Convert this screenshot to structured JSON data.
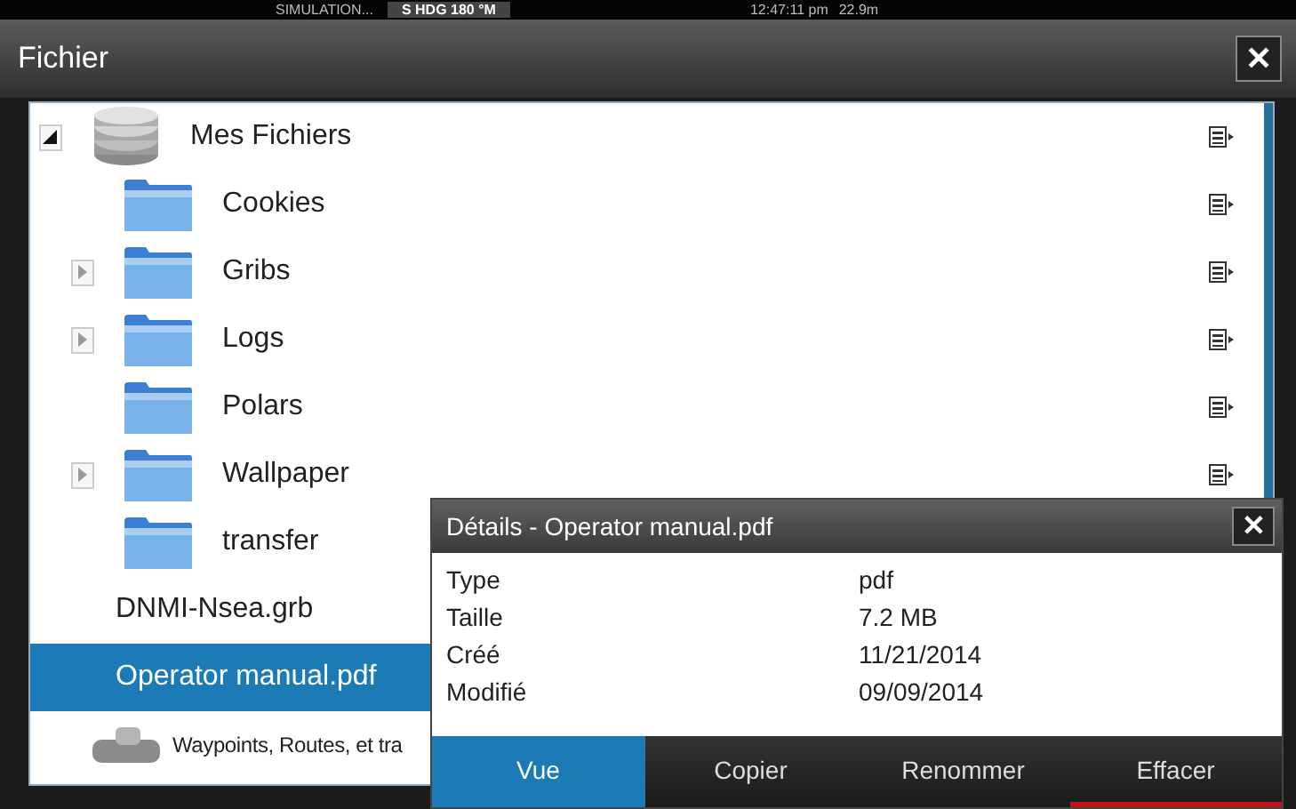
{
  "status_bar": {
    "mode": "SIMULATION...",
    "heading": "S HDG 180 °M",
    "time": "12:47:11 pm",
    "depth": "22.9m"
  },
  "window": {
    "title": "Fichier",
    "close": "✕"
  },
  "files": [
    {
      "name": "Mes Fichiers",
      "kind": "drive",
      "expandable": true,
      "expanded": true,
      "menu": true,
      "selected": false,
      "children": [
        {
          "name": "Cookies",
          "kind": "folder",
          "expandable": false,
          "menu": true,
          "selected": false
        },
        {
          "name": "Gribs",
          "kind": "folder",
          "expandable": true,
          "expanded": false,
          "menu": true,
          "selected": false
        },
        {
          "name": "Logs",
          "kind": "folder",
          "expandable": true,
          "expanded": false,
          "menu": true,
          "selected": false
        },
        {
          "name": "Polars",
          "kind": "folder",
          "expandable": false,
          "menu": true,
          "selected": false
        },
        {
          "name": "Wallpaper",
          "kind": "folder",
          "expandable": true,
          "expanded": false,
          "menu": true,
          "selected": false
        },
        {
          "name": "transfer",
          "kind": "folder",
          "expandable": false,
          "selected": false
        },
        {
          "name": "DNMI-Nsea.grb",
          "kind": "file",
          "expandable": false,
          "selected": false
        },
        {
          "name": "Operator manual.pdf",
          "kind": "file",
          "expandable": false,
          "selected": true
        }
      ]
    },
    {
      "name": "Waypoints, Routes, et tra",
      "kind": "database",
      "expandable": false,
      "selected": false
    }
  ],
  "details": {
    "title": "Détails - Operator manual.pdf",
    "close": "✕",
    "fields": [
      {
        "label": "Type",
        "value": "pdf"
      },
      {
        "label": "Taille",
        "value": "7.2 MB"
      },
      {
        "label": "Créé",
        "value": "11/21/2014"
      },
      {
        "label": "Modifié",
        "value": "09/09/2014"
      }
    ],
    "buttons": [
      {
        "label": "Vue",
        "selected": true,
        "kind": "normal"
      },
      {
        "label": "Copier",
        "selected": false,
        "kind": "normal"
      },
      {
        "label": "Renommer",
        "selected": false,
        "kind": "normal"
      },
      {
        "label": "Effacer",
        "selected": false,
        "kind": "delete"
      }
    ]
  }
}
